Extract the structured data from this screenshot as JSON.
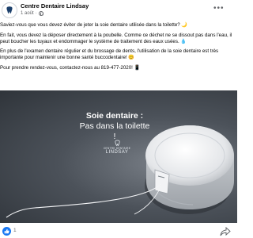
{
  "post": {
    "page_name": "Centre Dentaire Lindsay",
    "date": "1 août",
    "separator": "·",
    "paragraphs": [
      "Saviez-vous que vous devez éviter de jeter la soie dentaire utilisée dans la toilette? 🌙",
      "En fait, vous devez la déposer directement à la poubelle. Comme ce déchet ne se dissout pas dans l'eau, il peut boucher les tuyaux et endommager le système de traitement des eaux usées. 💧",
      "En plus de l'examen dentaire régulier et du brossage de dents, l'utilisation de la soie dentaire est très importante pour maintenir une bonne santé buccodentaire! 😊",
      "Pour prendre rendez-vous, contactez-nous au 819-477-2020! 📱"
    ]
  },
  "image": {
    "title_line1": "Soie dentaire :",
    "title_line2": "Pas dans la toilette !",
    "brand_line1": "CENTRE DENTAIRE",
    "brand_line2": "LINDSAY"
  },
  "reactions": {
    "like_count": "1",
    "like_icon": "thumbs-up-icon",
    "share_icon": "share-icon"
  },
  "colors": {
    "accent": "#1877f2",
    "text": "#050505",
    "muted": "#65676b"
  }
}
